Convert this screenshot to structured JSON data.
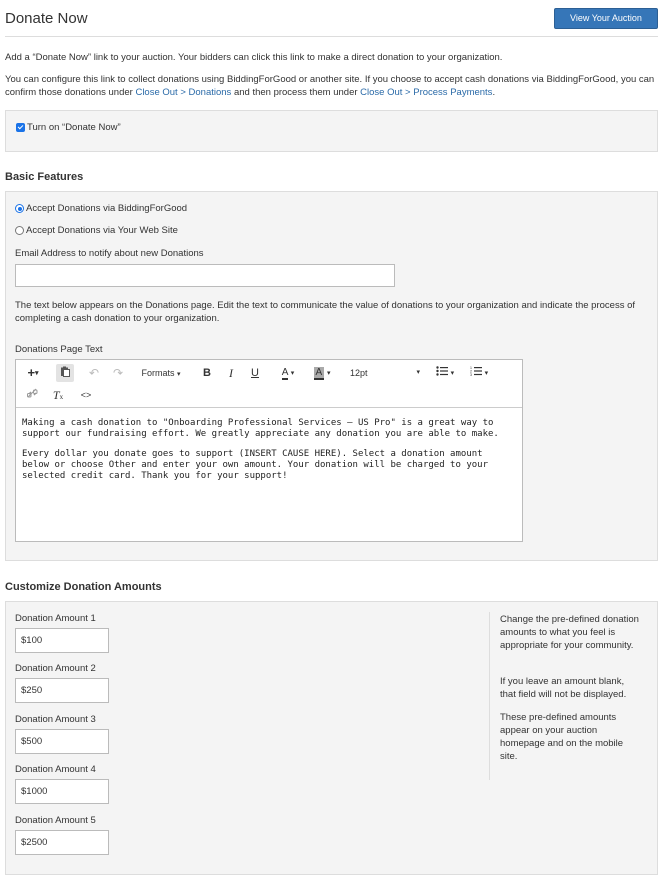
{
  "header": {
    "title": "Donate Now",
    "view_button": "View Your Auction"
  },
  "intro": {
    "line1": "Add a “Donate Now” link to your auction. Your bidders can click this link to make a direct donation to your organization.",
    "line2_before": "You can configure this link to collect donations using BiddingForGood or another site. If you choose to accept cash donations via BiddingForGood, you can confirm those donations under ",
    "link_donations": "Close Out > Donations",
    "line2_middle": " and then process them under ",
    "link_payments": "Close Out > Process Payments",
    "line2_after": "."
  },
  "toggle": {
    "label": "Turn on “Donate Now”",
    "checked": true
  },
  "basic": {
    "title": "Basic Features",
    "option1": "Accept Donations via BiddingForGood",
    "option2": "Accept Donations via Your Web Site",
    "email_label": "Email Address to notify about new Donations",
    "email_value": "",
    "description": "The text below appears on the Donations page. Edit the text to communicate the value of donations to your organization and indicate the process of completing a cash donation to your organization.",
    "editor_label": "Donations Page Text",
    "toolbar": {
      "formats": "Formats",
      "font_size": "12pt"
    },
    "editor_p1": "Making a cash donation to \"Onboarding Professional Services – US Pro\" is a great way to support our fundraising effort. We greatly appreciate any donation you are able to make.",
    "editor_p2": "Every dollar you donate goes to support (INSERT CAUSE HERE). Select a donation amount below or choose Other and enter your own amount. Your donation will be charged to your selected credit card. Thank you for your support!"
  },
  "amounts": {
    "title": "Customize Donation Amounts",
    "items": [
      {
        "label": "Donation Amount 1",
        "value": "$100"
      },
      {
        "label": "Donation Amount 2",
        "value": "$250"
      },
      {
        "label": "Donation Amount 3",
        "value": "$500"
      },
      {
        "label": "Donation Amount 4",
        "value": "$1000"
      },
      {
        "label": "Donation Amount 5",
        "value": "$2500"
      }
    ],
    "help1": "Change the pre-defined donation amounts to what you feel is appropriate for your community.",
    "help2": "If you leave an amount blank, that field will not be displayed.",
    "help3": "These pre-defined amounts appear on your auction homepage and on the mobile site."
  },
  "icons": {
    "insert": "plus-icon",
    "paste": "paste-icon",
    "undo": "undo-icon",
    "redo": "redo-icon",
    "bold": "bold-icon",
    "italic": "italic-icon",
    "underline": "underline-icon",
    "text_color": "text-color-icon",
    "bg_color": "background-color-icon",
    "bullet_list": "bullet-list-icon",
    "numbered_list": "numbered-list-icon",
    "unlink": "unlink-icon",
    "clear_format": "clear-formatting-icon",
    "source": "source-code-icon"
  },
  "colors": {
    "accent": "#3676b8",
    "link": "#2a6aa8",
    "panel": "#f4f4f4"
  }
}
